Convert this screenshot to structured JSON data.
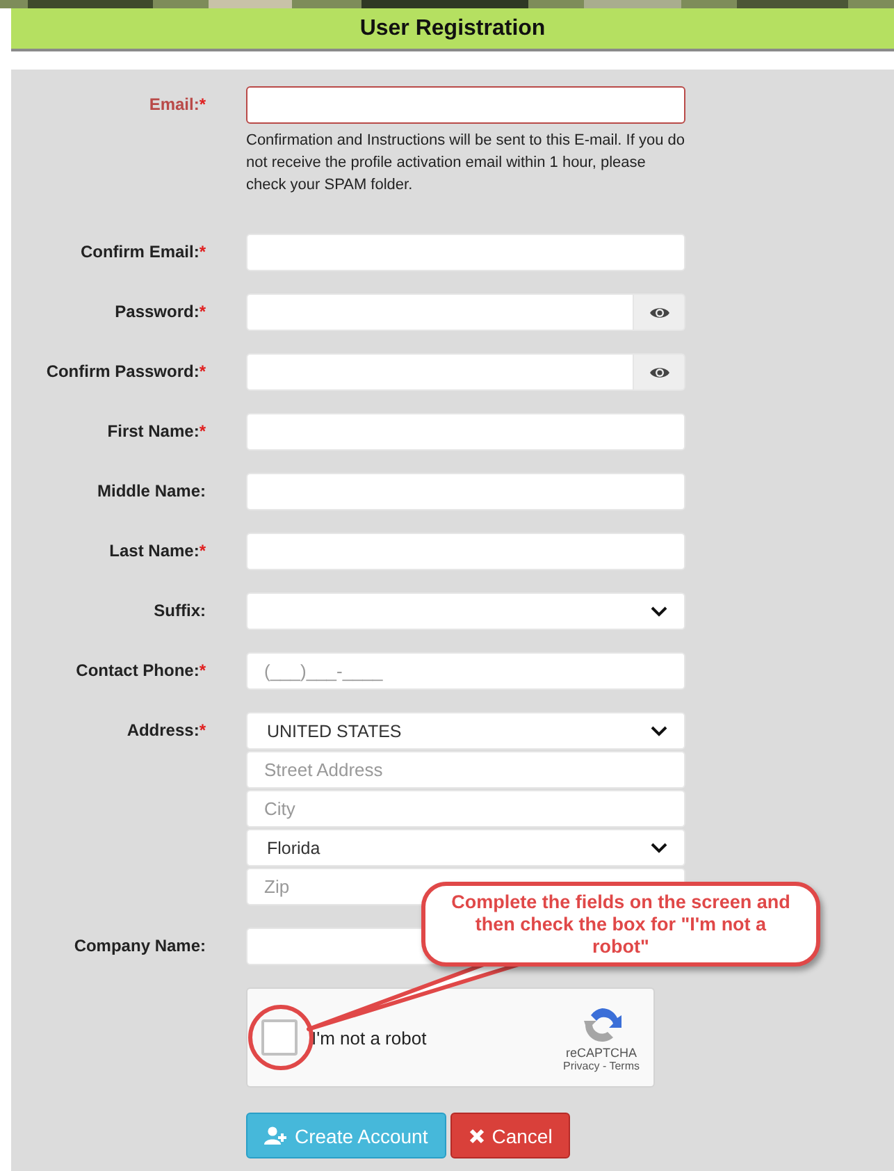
{
  "header": {
    "title": "User Registration"
  },
  "fields": [
    {
      "label": "Email:",
      "required_mark": "*",
      "invalid": true,
      "kind": "text",
      "help": "Confirmation and Instructions will be sent to this E-mail. If you do not receive the profile activation email within 1 hour, please check your SPAM folder."
    },
    {
      "label": "Confirm Email:",
      "required_mark": "*",
      "invalid": false,
      "kind": "text"
    },
    {
      "label": "Password:",
      "required_mark": "*",
      "invalid": false,
      "kind": "password"
    },
    {
      "label": "Confirm Password:",
      "required_mark": "*",
      "invalid": false,
      "kind": "password"
    },
    {
      "label": "First Name:",
      "required_mark": "*",
      "invalid": false,
      "kind": "text"
    },
    {
      "label": "Middle Name:",
      "invalid": false,
      "kind": "text"
    },
    {
      "label": "Last Name:",
      "required_mark": "*",
      "invalid": false,
      "kind": "text"
    },
    {
      "label": "Suffix:",
      "invalid": false,
      "kind": "select"
    },
    {
      "label": "Contact Phone:",
      "required_mark": "*",
      "invalid": false,
      "kind": "text",
      "placeholder": "(___)___-____"
    },
    {
      "label": "Address:",
      "required_mark": "*",
      "invalid": false,
      "kind": "address",
      "parts": [
        {
          "kind": "select",
          "value": "UNITED STATES"
        },
        {
          "kind": "text",
          "placeholder": "Street Address"
        },
        {
          "kind": "text",
          "placeholder": "City"
        },
        {
          "kind": "select",
          "value": "Florida"
        },
        {
          "kind": "text",
          "placeholder": "Zip"
        }
      ]
    },
    {
      "label": "Company Name:",
      "invalid": false,
      "kind": "text"
    }
  ],
  "captcha": {
    "label": "I'm not a robot",
    "checked": false,
    "brand": "reCAPTCHA",
    "links": "Privacy - Terms"
  },
  "buttons": [
    {
      "kind": "primary",
      "label": "Create Account"
    },
    {
      "kind": "danger",
      "label": "Cancel"
    }
  ],
  "callout": {
    "text": "Complete the fields on the screen and then check the box for \"I'm not a robot\""
  }
}
